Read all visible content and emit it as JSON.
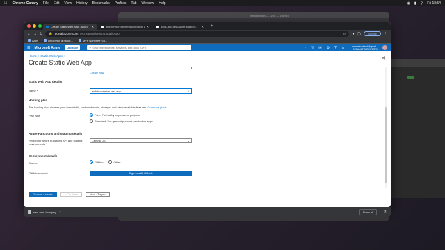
{
  "menubar": {
    "apple": "",
    "app": "Chrome Canary",
    "items": [
      "File",
      "Edit",
      "View",
      "History",
      "Bookmarks",
      "Profiles",
      "Tab",
      "Window",
      "Help"
    ],
    "clock": "Fri 18:54"
  },
  "bg_window_title": "natalia@dev — -zsh — 108×45",
  "tabs": [
    {
      "title": "Create Static Web App - Micro",
      "active": true
    },
    {
      "title": "anthonyscreative/ballooncapp: A",
      "active": false
    },
    {
      "title": "docs-app-test/azure-static-w...",
      "active": false
    }
  ],
  "omnibox": {
    "host": "portal.azure.com",
    "path": "/#create/Microsoft.StaticApp"
  },
  "update_label": "Update",
  "bookmarks": [
    "Apps",
    "Deploying a Static...",
    "MVP Nominee Gu..."
  ],
  "azure": {
    "brand": "Microsoft Azure",
    "upgrade": "Upgrade",
    "search_placeholder": "Search resources, services, and docs (G+/)",
    "user_name": "nataliafrontend@gmail...",
    "user_dir": "DEFAULT DIRECTORY"
  },
  "breadcrumb": [
    "Home",
    ">",
    "Static Web Apps",
    ">"
  ],
  "page_title": "Create Static Web App",
  "create_new": "Create new",
  "details": {
    "heading": "Static Web App details",
    "name_label": "Name *",
    "name_value": "anthbscreative-test-app"
  },
  "hosting": {
    "heading": "Hosting plan",
    "desc": "The hosting plan dictates your bandwidth, custom domain, storage, and other available features.",
    "compare_link": "Compare plans",
    "plan_label": "Plan type",
    "options": [
      "Free: For hobby or personal projects",
      "Standard: For general purpose production apps"
    ]
  },
  "functions": {
    "heading": "Azure Functions and staging details",
    "region_label": "Region for Azure Functions API and staging environments *",
    "region_value": "Central US"
  },
  "deployment": {
    "heading": "Deployment details",
    "source_label": "Source",
    "sources": [
      "GitHub",
      "Other"
    ],
    "account_label": "GitHub account",
    "signin_label": "Sign in with GitHub"
  },
  "footer": {
    "review": "Review + create",
    "previous": "< Previous",
    "next": "Next : Tags >"
  },
  "downloads": {
    "file": "swa-emu-icon.png",
    "show_all": "Show all"
  }
}
